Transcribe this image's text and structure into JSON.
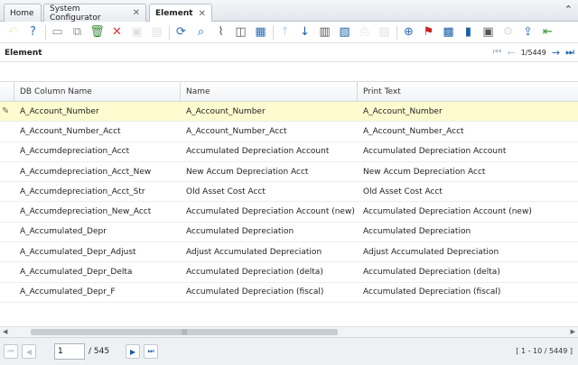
{
  "tabs": [
    {
      "label": "Home",
      "closable": false,
      "active": false
    },
    {
      "label": "System Configurator",
      "closable": true,
      "active": false
    },
    {
      "label": "Element",
      "closable": true,
      "active": true
    }
  ],
  "toolbar": {
    "icons": [
      {
        "name": "undo-icon",
        "glyph": "↶",
        "disabled": true
      },
      {
        "name": "help-icon",
        "glyph": "?",
        "disabled": false
      },
      {
        "name": "new-record-icon",
        "glyph": "▭",
        "disabled": false
      },
      {
        "name": "copy-record-icon",
        "glyph": "⧉",
        "disabled": false
      },
      {
        "name": "delete-icon",
        "glyph": "🗑",
        "disabled": false
      },
      {
        "name": "delete-selection-icon",
        "glyph": "✕",
        "disabled": false
      },
      {
        "name": "save-icon",
        "glyph": "▣",
        "disabled": true
      },
      {
        "name": "save-new-icon",
        "glyph": "▤",
        "disabled": true
      },
      {
        "name": "refresh-icon",
        "glyph": "⟳",
        "disabled": false
      },
      {
        "name": "find-icon",
        "glyph": "⌕",
        "disabled": false
      },
      {
        "name": "attachment-icon",
        "glyph": "⌇",
        "disabled": false
      },
      {
        "name": "chat-icon",
        "glyph": "◫",
        "disabled": false
      },
      {
        "name": "grid-toggle-icon",
        "glyph": "▦",
        "disabled": false
      },
      {
        "name": "parent-record-icon",
        "glyph": "↑",
        "disabled": true
      },
      {
        "name": "detail-record-icon",
        "glyph": "↓",
        "disabled": false
      },
      {
        "name": "history-icon",
        "glyph": "▥",
        "disabled": false
      },
      {
        "name": "report-icon",
        "glyph": "▧",
        "disabled": false
      },
      {
        "name": "print-icon",
        "glyph": "⎙",
        "disabled": true
      },
      {
        "name": "archive-icon",
        "glyph": "▨",
        "disabled": true
      },
      {
        "name": "zoom-across-icon",
        "glyph": "⊕",
        "disabled": false
      },
      {
        "name": "requests-icon",
        "glyph": "⚑",
        "disabled": false
      },
      {
        "name": "product-info-icon",
        "glyph": "▩",
        "disabled": false
      },
      {
        "name": "lock-icon",
        "glyph": "▮",
        "disabled": false
      },
      {
        "name": "customize-icon",
        "glyph": "▣",
        "disabled": false
      },
      {
        "name": "settings-icon",
        "glyph": "⚙",
        "disabled": true
      },
      {
        "name": "export-icon",
        "glyph": "⇪",
        "disabled": false
      },
      {
        "name": "import-icon",
        "glyph": "⇤",
        "disabled": false
      }
    ]
  },
  "window": {
    "title": "Element",
    "record_position": "1/5449"
  },
  "grid": {
    "columns": [
      "DB Column Name",
      "Name",
      "Print Text"
    ],
    "rows": [
      [
        "A_Account_Number",
        "A_Account_Number",
        "A_Account_Number"
      ],
      [
        "A_Account_Number_Acct",
        "A_Account_Number_Acct",
        "A_Account_Number_Acct"
      ],
      [
        "A_Accumdepreciation_Acct",
        "Accumulated Depreciation Account",
        "Accumulated Depreciation Account"
      ],
      [
        "A_Accumdepreciation_Acct_New",
        "New Accum Depreciation Acct",
        "New Accum Depreciation Acct"
      ],
      [
        "A_Accumdepreciation_Acct_Str",
        "Old Asset Cost Acct",
        "Old Asset Cost Acct"
      ],
      [
        "A_Accumdepreciation_New_Acct",
        "Accumulated Depreciation Account (new)",
        "Accumulated Depreciation Account (new)"
      ],
      [
        "A_Accumulated_Depr",
        "Accumulated Depreciation",
        "Accumulated Depreciation"
      ],
      [
        "A_Accumulated_Depr_Adjust",
        "Adjust Accumulated Depreciation",
        "Adjust Accumulated Depreciation"
      ],
      [
        "A_Accumulated_Depr_Delta",
        "Accumulated Depreciation (delta)",
        "Accumulated Depreciation (delta)"
      ],
      [
        "A_Accumulated_Depr_F",
        "Accumulated Depreciation (fiscal)",
        "Accumulated Depreciation (fiscal)"
      ]
    ],
    "selected_row": 0
  },
  "pager": {
    "current_page": "1",
    "total_pages": "/ 545",
    "range_info": "[ 1 - 10 / 5449 ]"
  },
  "colors": {
    "accent": "#1a5fa8",
    "selected_row": "#fdfbcf"
  }
}
